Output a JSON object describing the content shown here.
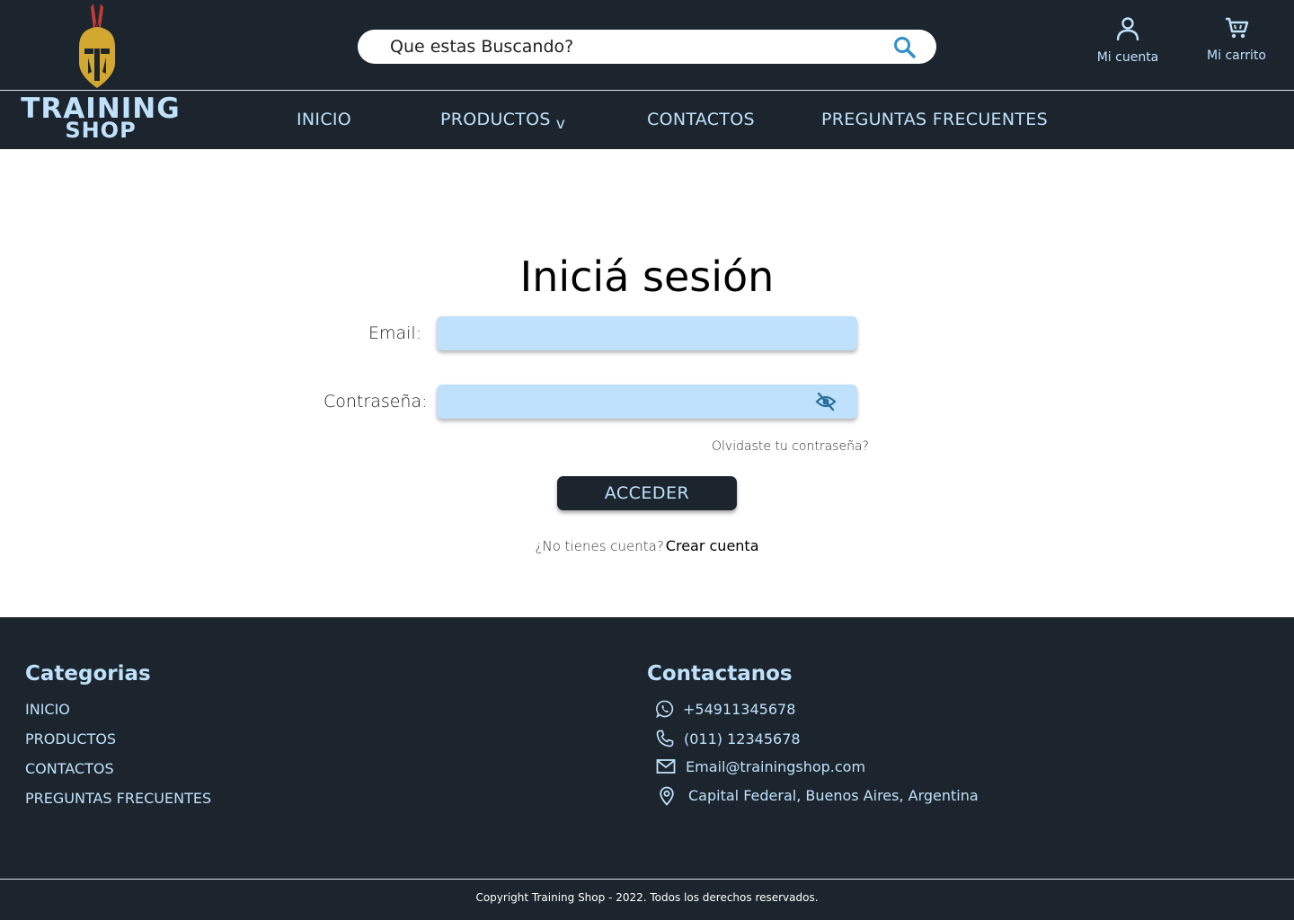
{
  "brand": {
    "line1": "TRAINING",
    "line2": "SHOP"
  },
  "search": {
    "placeholder": "Que estas Buscando?"
  },
  "header": {
    "account_label": "Mi cuenta",
    "cart_label": "Mi carrito"
  },
  "nav": {
    "inicio": "INICIO",
    "productos": "PRODUCTOS",
    "productos_caret": "v",
    "contactos": "CONTACTOS",
    "faq": "PREGUNTAS FRECUENTES"
  },
  "login": {
    "title": "Iniciá sesión",
    "email_label": "Email:",
    "password_label": "Contraseña:",
    "forgot": "Olvidaste tu contraseña?",
    "submit": "ACCEDER",
    "no_account": "¿No tienes cuenta?",
    "create_account": "Crear cuenta"
  },
  "footer": {
    "categories_title": "Categorias",
    "categories": [
      "INICIO",
      "PRODUCTOS",
      "CONTACTOS",
      "PREGUNTAS FRECUENTES"
    ],
    "contact_title": "Contactanos",
    "whatsapp": "+54911345678",
    "phone": "(011) 12345678",
    "email": "Email@trainingshop.com",
    "address": "Capital Federal, Buenos Aires, Argentina",
    "copyright": "Copyright Training Shop - 2022. Todos los derechos reservados."
  },
  "colors": {
    "header_bg": "#1c252d",
    "accent_light": "#bfe1fb",
    "search_icon": "#2f8fc9"
  },
  "icons": [
    "helmet-logo-icon",
    "search-icon",
    "user-icon",
    "cart-icon",
    "eye-off-icon",
    "whatsapp-icon",
    "phone-icon",
    "mail-icon",
    "location-pin-icon"
  ]
}
